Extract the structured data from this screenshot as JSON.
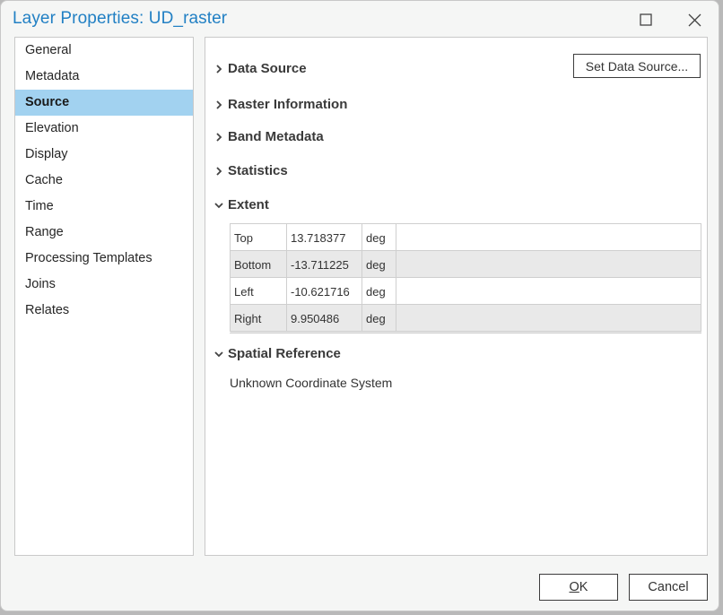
{
  "window": {
    "title": "Layer Properties: UD_raster",
    "maximize_icon": "maximize-icon",
    "close_icon": "close-icon"
  },
  "sidebar": {
    "selected": "Source",
    "items": [
      {
        "label": "General"
      },
      {
        "label": "Metadata"
      },
      {
        "label": "Source"
      },
      {
        "label": "Elevation"
      },
      {
        "label": "Display"
      },
      {
        "label": "Cache"
      },
      {
        "label": "Time"
      },
      {
        "label": "Range"
      },
      {
        "label": "Processing Templates"
      },
      {
        "label": "Joins"
      },
      {
        "label": "Relates"
      }
    ]
  },
  "content": {
    "set_data_source_label": "Set Data Source...",
    "sections": [
      {
        "label": "Data Source",
        "expanded": false,
        "icon": "chevron-right-icon"
      },
      {
        "label": "Raster Information",
        "expanded": false,
        "icon": "chevron-right-icon"
      },
      {
        "label": "Band Metadata",
        "expanded": false,
        "icon": "chevron-right-icon"
      },
      {
        "label": "Statistics",
        "expanded": false,
        "icon": "chevron-right-icon"
      },
      {
        "label": "Extent",
        "expanded": true,
        "icon": "chevron-down-icon"
      },
      {
        "label": "Spatial Reference",
        "expanded": true,
        "icon": "chevron-down-icon"
      }
    ],
    "extent": {
      "rows": [
        {
          "name": "Top",
          "value": "13.718377",
          "unit": "deg"
        },
        {
          "name": "Bottom",
          "value": "-13.711225",
          "unit": "deg"
        },
        {
          "name": "Left",
          "value": "-10.621716",
          "unit": "deg"
        },
        {
          "name": "Right",
          "value": "9.950486",
          "unit": "deg"
        }
      ]
    },
    "spatial_reference": {
      "text": "Unknown Coordinate System"
    }
  },
  "footer": {
    "ok_mnemonic": "O",
    "ok_rest": "K",
    "cancel_label": "Cancel"
  },
  "colors": {
    "title": "#2280c4",
    "selected_bg": "#a2d2f0",
    "dialog_bg": "#f5f6f5"
  }
}
